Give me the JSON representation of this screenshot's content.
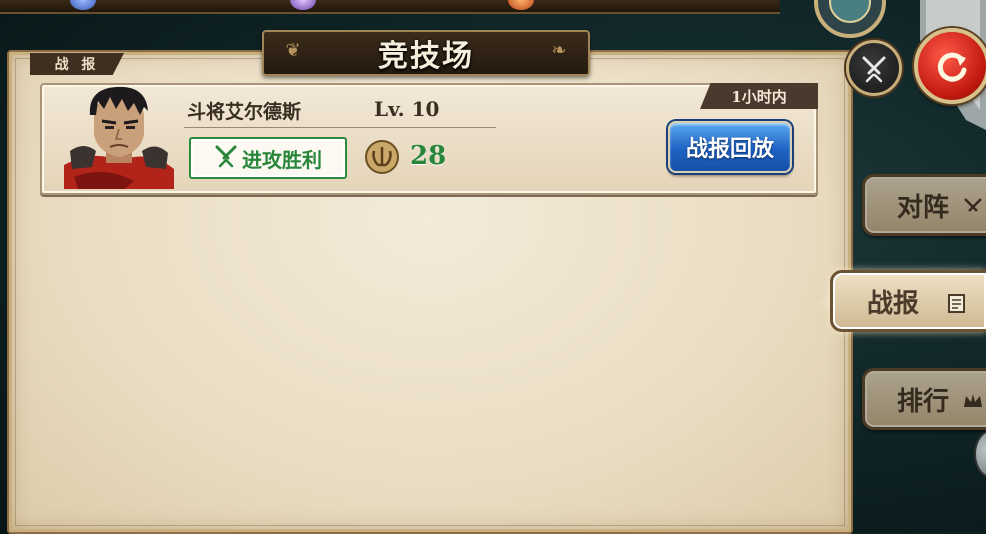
{
  "screen": {
    "title": "竞技场",
    "section_tag": "战 报"
  },
  "battle_record": {
    "player_name": "斗将艾尔德斯",
    "level": "Lv. 10",
    "result": "进攻胜利",
    "trophy_points": "28",
    "time_ago": "1小时内",
    "replay_label": "战报回放"
  },
  "side_tabs": [
    {
      "label": "对阵",
      "icon": "crossed-swords-icon",
      "active": false
    },
    {
      "label": "战报",
      "icon": "scroll-icon",
      "active": true
    },
    {
      "label": "排行",
      "icon": "crown-icon",
      "active": false
    }
  ],
  "colors": {
    "victory_green": "#27863a",
    "replay_blue": "#1e63c4",
    "panel_parchment": "#efe4cf",
    "refresh_red": "#c31a10"
  }
}
